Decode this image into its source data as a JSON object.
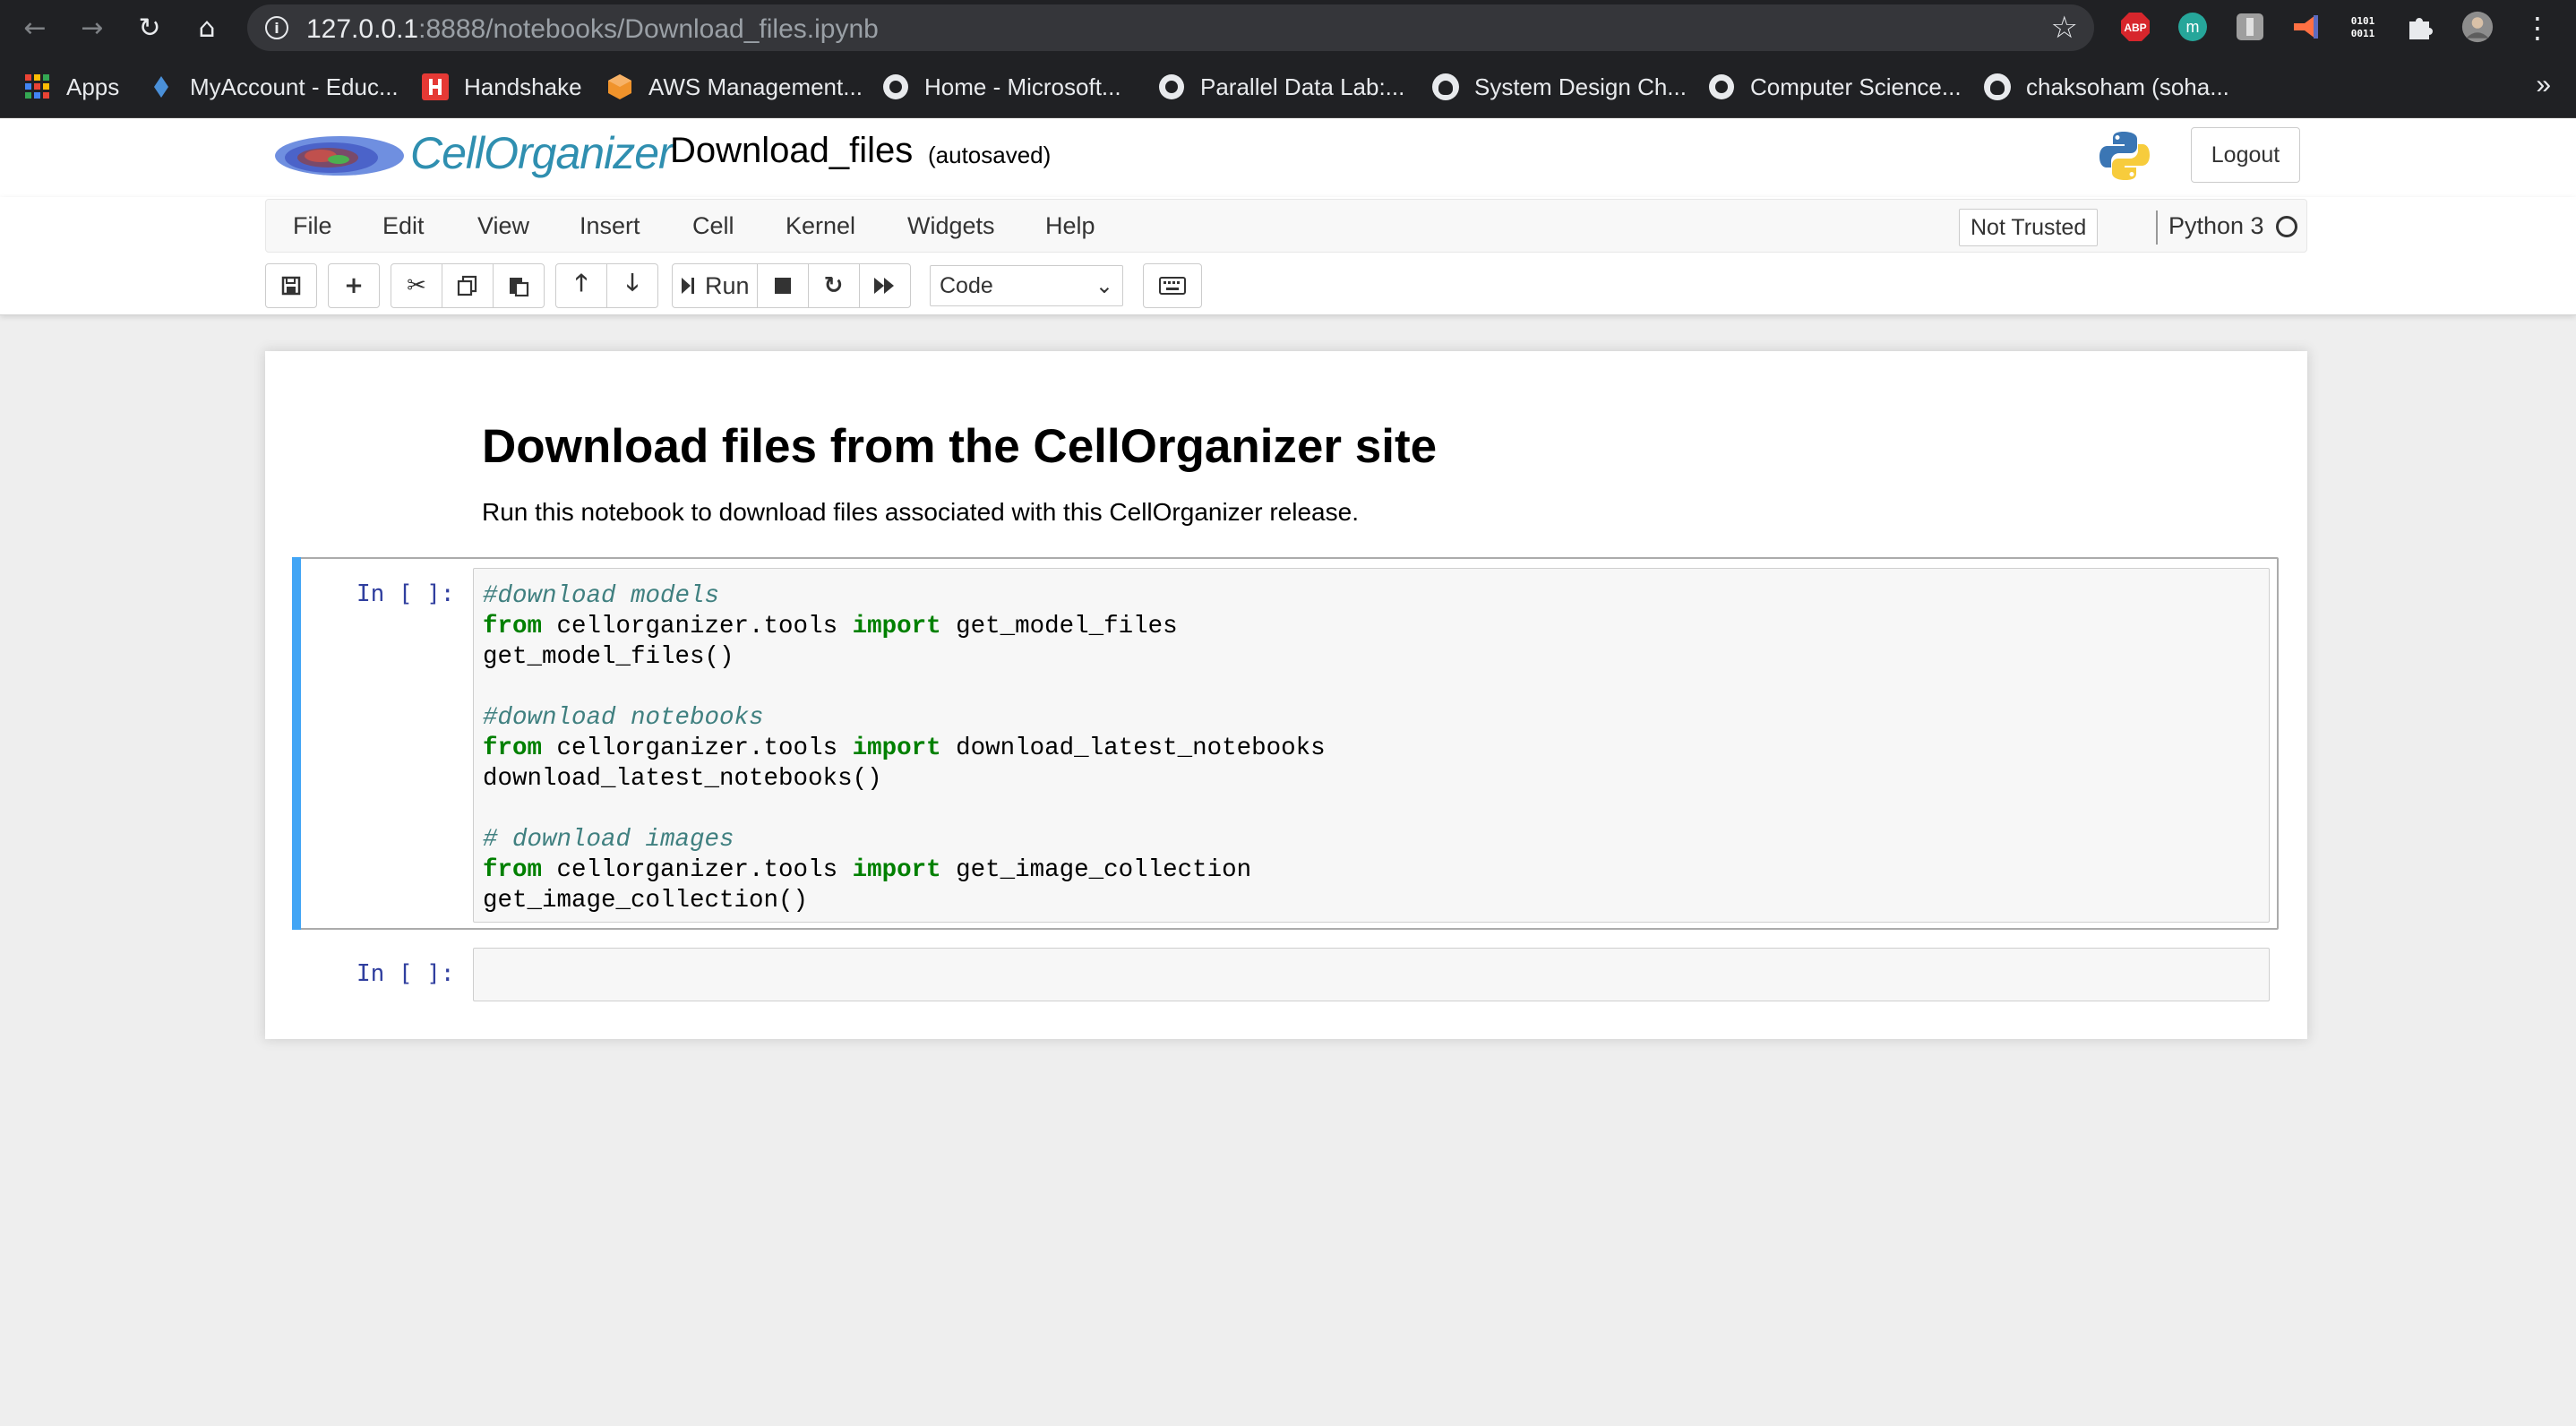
{
  "browser": {
    "url_host": "127.0.0.1",
    "url_path": ":8888/notebooks/Download_files.ipynb",
    "bookmarks": [
      {
        "label": "Apps"
      },
      {
        "label": "MyAccount - Educ..."
      },
      {
        "label": "Handshake"
      },
      {
        "label": "AWS Management..."
      },
      {
        "label": "Home - Microsoft..."
      },
      {
        "label": "Parallel Data Lab:..."
      },
      {
        "label": "System Design Ch..."
      },
      {
        "label": "Computer Science..."
      },
      {
        "label": "chaksoham (soha..."
      }
    ],
    "more_bookmarks": "»",
    "extensions": {
      "abp": "ABP",
      "binary": "0101\n0011"
    }
  },
  "header": {
    "logo_text": "CellOrganizer",
    "notebook_name": "Download_files",
    "autosave_status": "(autosaved)",
    "logout_label": "Logout"
  },
  "menubar": {
    "items": [
      "File",
      "Edit",
      "View",
      "Insert",
      "Cell",
      "Kernel",
      "Widgets",
      "Help"
    ],
    "trust_status": "Not Trusted",
    "kernel_name": "Python 3"
  },
  "toolbar": {
    "run_label": "Run",
    "cell_type": "Code"
  },
  "notebook": {
    "title": "Download files from the CellOrganizer site",
    "intro": "Run this notebook to download files associated with this CellOrganizer release.",
    "cells": [
      {
        "prompt": "In [ ]:",
        "lines": [
          [
            {
              "t": "cm",
              "s": "#download models"
            }
          ],
          [
            {
              "t": "kw",
              "s": "from"
            },
            {
              "t": "n",
              "s": " cellorganizer.tools "
            },
            {
              "t": "kw",
              "s": "import"
            },
            {
              "t": "n",
              "s": " get_model_files"
            }
          ],
          [
            {
              "t": "n",
              "s": "get_model_files()"
            }
          ],
          [],
          [
            {
              "t": "cm",
              "s": "#download notebooks"
            }
          ],
          [
            {
              "t": "kw",
              "s": "from"
            },
            {
              "t": "n",
              "s": " cellorganizer.tools "
            },
            {
              "t": "kw",
              "s": "import"
            },
            {
              "t": "n",
              "s": " download_latest_notebooks"
            }
          ],
          [
            {
              "t": "n",
              "s": "download_latest_notebooks()"
            }
          ],
          [],
          [
            {
              "t": "cm",
              "s": "# download images"
            }
          ],
          [
            {
              "t": "kw",
              "s": "from"
            },
            {
              "t": "n",
              "s": " cellorganizer.tools "
            },
            {
              "t": "kw",
              "s": "import"
            },
            {
              "t": "n",
              "s": " get_image_collection"
            }
          ],
          [
            {
              "t": "n",
              "s": "get_image_collection()"
            }
          ]
        ]
      },
      {
        "prompt": "In [ ]:",
        "lines": []
      }
    ]
  },
  "colors": {
    "chrome_bg": "#202124",
    "cell_selected_bar": "#42a5f5",
    "prompt": "#303f9f",
    "keyword": "#008000",
    "comment": "#408080",
    "logo_text": "#2f8fb0"
  }
}
